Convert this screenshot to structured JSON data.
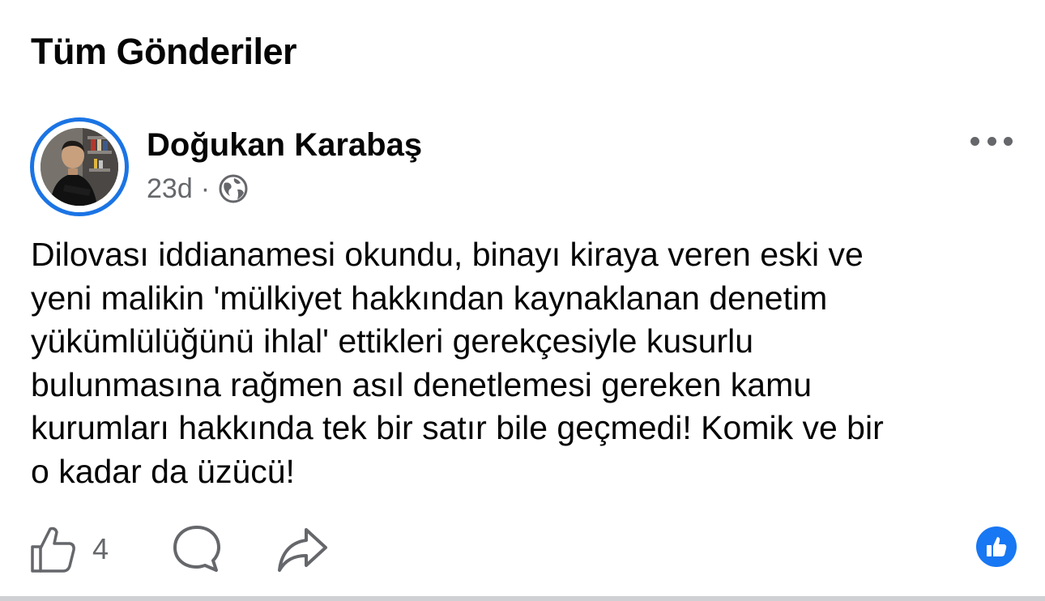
{
  "section": {
    "title": "Tüm Gönderiler"
  },
  "post": {
    "author": {
      "name": "Doğukan Karabaş",
      "avatar_icon": "profile-photo-icon"
    },
    "timestamp": "23d",
    "separator": "·",
    "privacy_icon": "globe-icon",
    "text": "Dilovası iddianamesi okundu, binayı kiraya veren eski ve\nyeni malikin 'mülkiyet hakkından kaynaklanan denetim\nyükümlülüğünü ihlal' ettikleri gerekçesiyle kusurlu\nbulunmasına rağmen asıl denetlemesi gereken kamu\nkurumları hakkında tek bir satır bile geçmedi! Komik ve bir\no kadar da üzücü!",
    "actions": {
      "like_icon": "thumbs-up-icon",
      "like_count": "4",
      "comment_icon": "comment-icon",
      "share_icon": "share-icon",
      "more_icon": "more-horizontal-icon"
    },
    "reaction_badge": {
      "icon": "like-reaction-icon",
      "color": "#1877f2"
    }
  },
  "colors": {
    "accent": "#1b74e4",
    "secondary_text": "#65676b",
    "primary_text": "#050505",
    "divider": "#ced0d4"
  }
}
